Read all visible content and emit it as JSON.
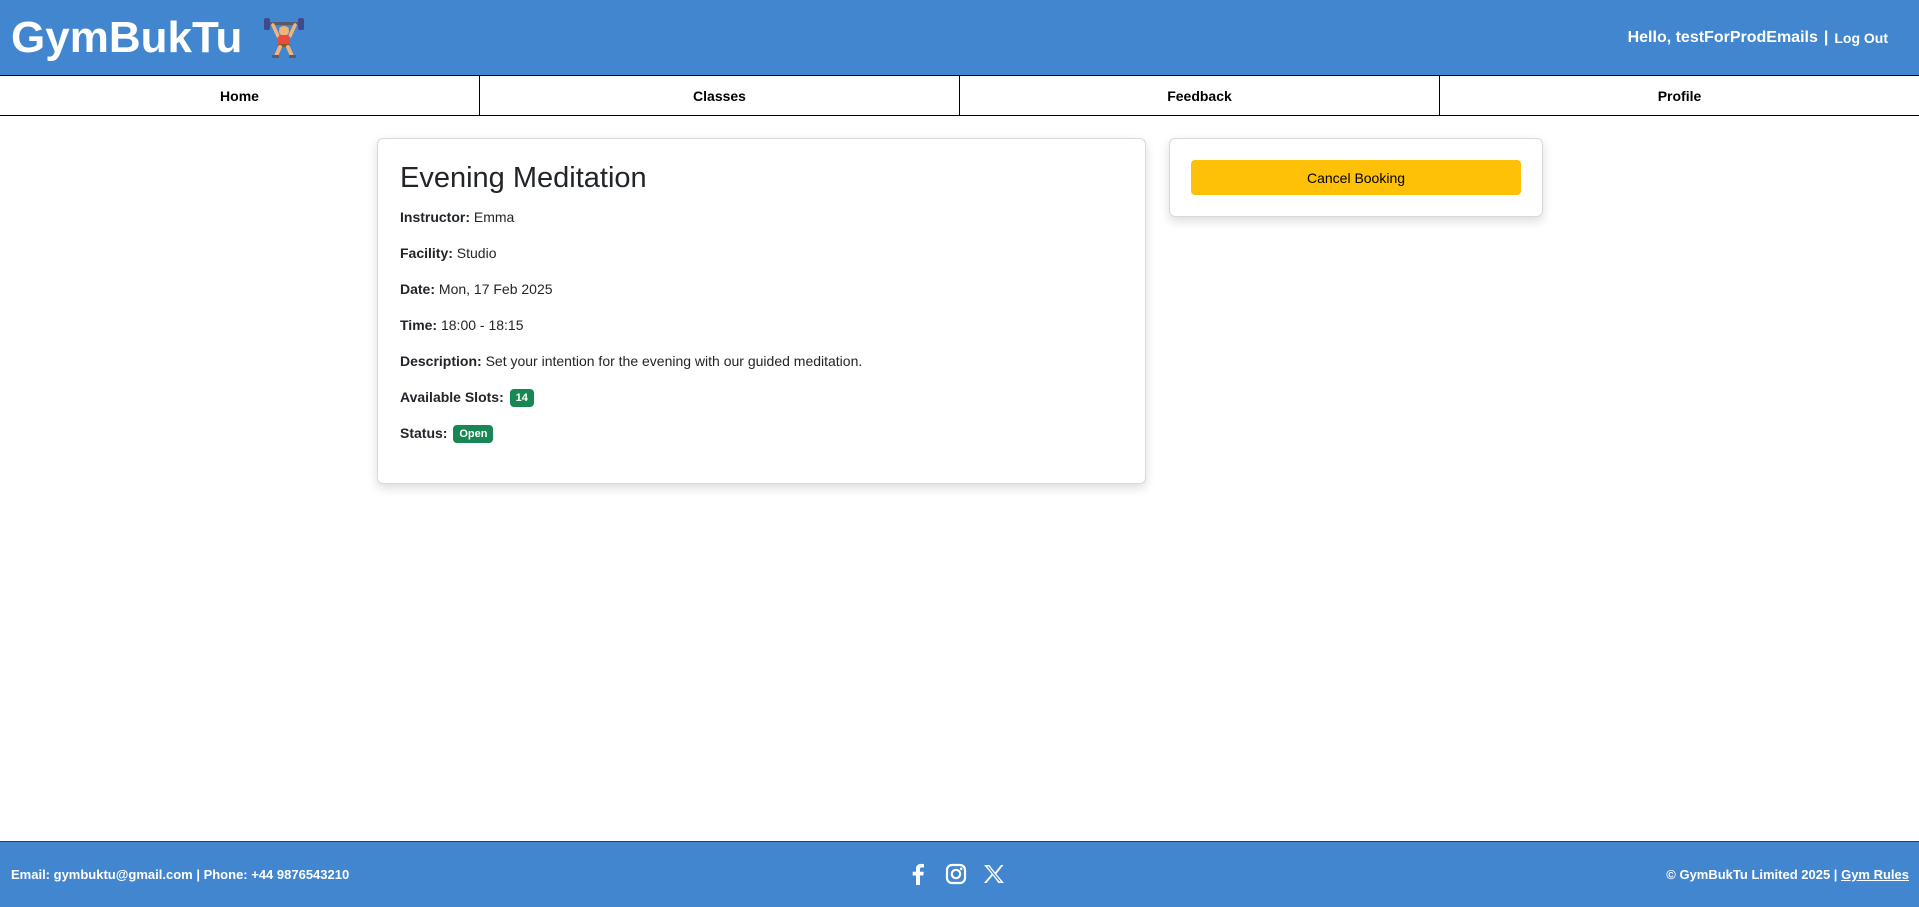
{
  "header": {
    "brand": "GymBukTu",
    "logo_icon": "weightlifter-icon",
    "greeting": "Hello, testForProdEmails",
    "separator": "|",
    "logout_label": "Log Out"
  },
  "nav": {
    "items": [
      {
        "label": "Home"
      },
      {
        "label": "Classes"
      },
      {
        "label": "Feedback"
      },
      {
        "label": "Profile"
      }
    ]
  },
  "class": {
    "title": "Evening Meditation",
    "instructor_label": "Instructor:",
    "instructor": "Emma",
    "facility_label": "Facility:",
    "facility": "Studio",
    "date_label": "Date:",
    "date": "Mon, 17 Feb 2025",
    "time_label": "Time:",
    "time": "18:00 - 18:15",
    "description_label": "Description:",
    "description": "Set your intention for the evening with our guided meditation.",
    "slots_label": "Available Slots:",
    "slots": "14",
    "status_label": "Status:",
    "status": "Open"
  },
  "actions": {
    "cancel_label": "Cancel Booking"
  },
  "footer": {
    "contact": "Email: gymbuktu@gmail.com | Phone: +44 9876543210",
    "social_icons": [
      "facebook-icon",
      "instagram-icon",
      "x-twitter-icon"
    ],
    "copyright": "© GymBukTu Limited 2025 |",
    "rules_link": "Gym Rules"
  },
  "colors": {
    "primary": "#4286d0",
    "badge_green": "#198754",
    "cancel_yellow": "#ffc107"
  }
}
